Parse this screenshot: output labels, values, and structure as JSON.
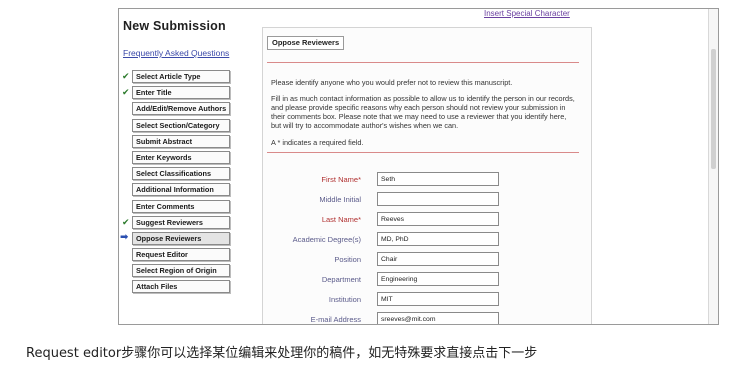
{
  "sidebar": {
    "title": "New Submission",
    "faq_link": "Frequently Asked Questions",
    "steps": [
      {
        "label": "Select Article Type",
        "done": true
      },
      {
        "label": "Enter Title",
        "done": true
      },
      {
        "label": "Add/Edit/Remove Authors",
        "done": false
      },
      {
        "label": "Select Section/Category",
        "done": false
      },
      {
        "label": "Submit Abstract",
        "done": false
      },
      {
        "label": "Enter Keywords",
        "done": false
      },
      {
        "label": "Select Classifications",
        "done": false
      },
      {
        "label": "Additional Information",
        "done": false
      },
      {
        "label": "Enter Comments",
        "done": false
      },
      {
        "label": "Suggest Reviewers",
        "done": true
      },
      {
        "label": "Oppose Reviewers",
        "current": true
      },
      {
        "label": "Request Editor",
        "done": false
      },
      {
        "label": "Select Region of Origin",
        "done": false
      },
      {
        "label": "Attach Files",
        "done": false
      }
    ]
  },
  "top_link": "Insert Special Character",
  "main": {
    "tab_label": "Oppose Reviewers",
    "intro": "Please identify anyone who you would prefer not to review this manuscript.",
    "instructions": "Fill in as much contact information as possible to allow us to identify the person in our records, and please provide specific reasons why each person should not review your submission in their comments box. Please note that we may need to use a reviewer that you identify here, but will try to accommodate author's wishes when we can.",
    "required_note": "A * indicates a required field.",
    "fields": [
      {
        "label": "First Name*",
        "value": "Seth",
        "required": true
      },
      {
        "label": "Middle Initial",
        "value": "",
        "required": false
      },
      {
        "label": "Last Name*",
        "value": "Reeves",
        "required": true
      },
      {
        "label": "Academic Degree(s)",
        "value": "MD, PhD",
        "required": false
      },
      {
        "label": "Position",
        "value": "Chair",
        "required": false
      },
      {
        "label": "Department",
        "value": "Engineering",
        "required": false
      },
      {
        "label": "Institution",
        "value": "MIT",
        "required": false
      },
      {
        "label": "E-mail Address",
        "value": "sreeves@mit.com",
        "required": false
      }
    ]
  },
  "caption": "Request editor步骤你可以选择某位编辑来处理你的稿件，如无特殊要求直接点击下一步",
  "colors": {
    "required": "#b03030",
    "check": "#2b7a2b",
    "arrow": "#2a4fb0",
    "link": "#3a48a8"
  }
}
